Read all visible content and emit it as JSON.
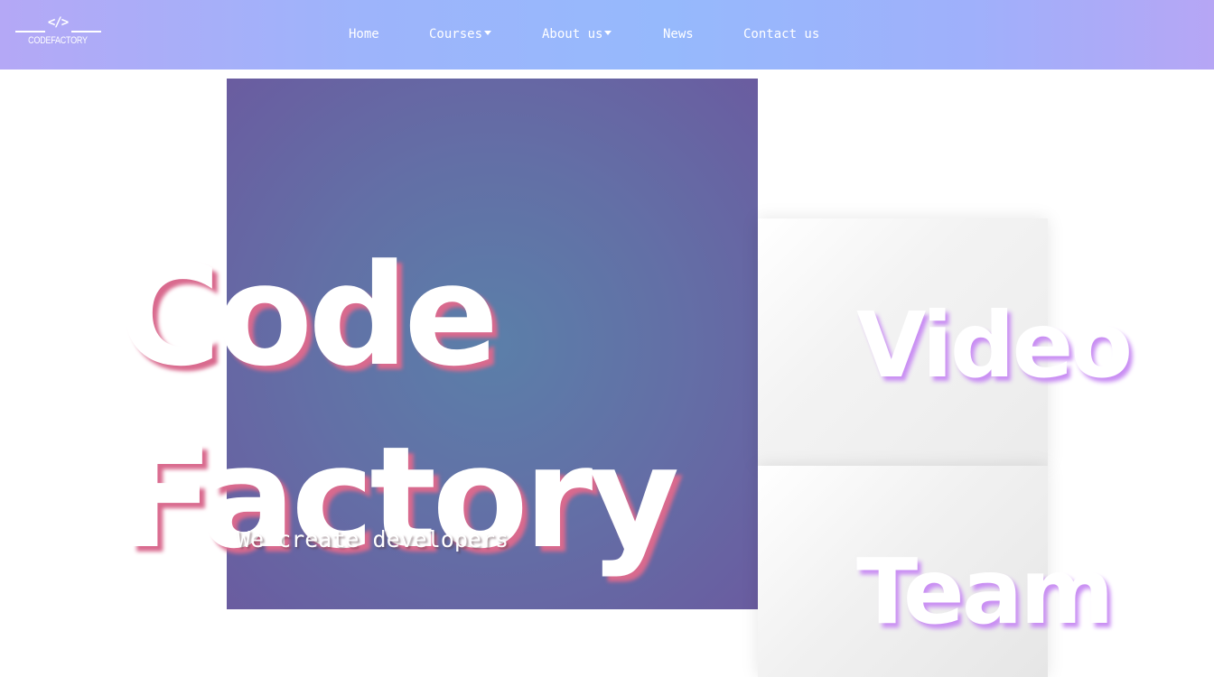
{
  "navbar": {
    "logo": {
      "symbol": "</>",
      "wordmark": "CODEFACTORY"
    },
    "items": [
      {
        "label": "Home",
        "has_dropdown": false
      },
      {
        "label": "Courses",
        "has_dropdown": true
      },
      {
        "label": "About us",
        "has_dropdown": true
      },
      {
        "label": "News",
        "has_dropdown": false
      },
      {
        "label": "Contact us",
        "has_dropdown": false
      }
    ]
  },
  "hero": {
    "title_line1": "Code",
    "title_line2": "Factory",
    "tagline": "We create developers"
  },
  "cards": {
    "video_label": "Video",
    "team_label": "Team"
  },
  "colors": {
    "nav_gradient_start": "#b4a8f6",
    "nav_gradient_mid": "#96b9fc",
    "hero_center": "#5b7fa9",
    "hero_edge": "#6a5ca0",
    "title_shadow": "#d96a8e",
    "card_label_shadow": "#c98ef3"
  }
}
